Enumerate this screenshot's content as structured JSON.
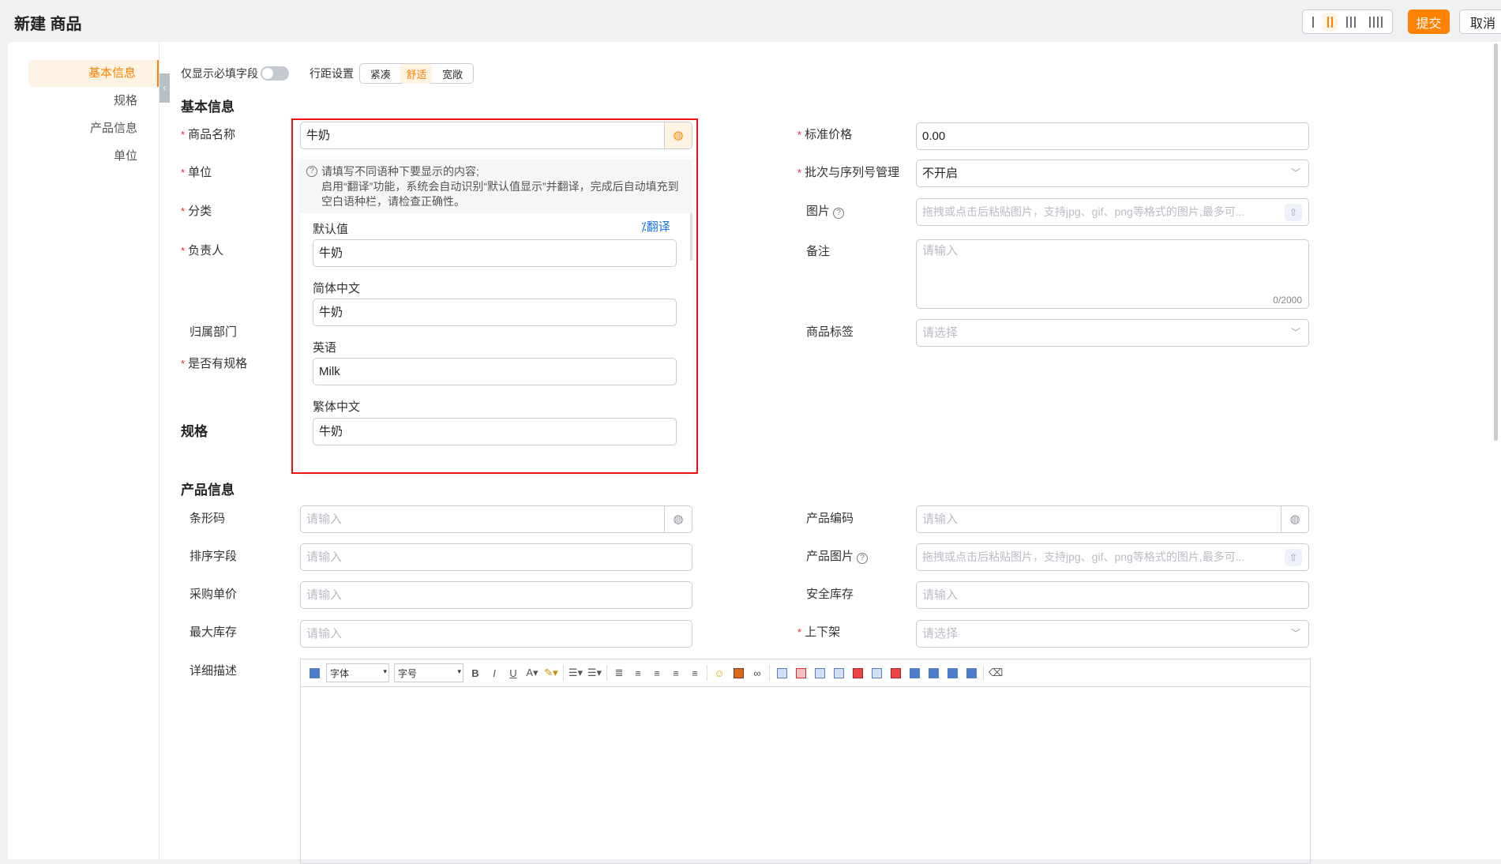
{
  "header": {
    "title": "新建 商品",
    "submit": "提交",
    "cancel": "取消",
    "density_options": [
      "1列",
      "2列",
      "3列",
      "4列"
    ],
    "density_selected": 1
  },
  "nav": {
    "items": [
      "基本信息",
      "规格",
      "产品信息",
      "单位"
    ],
    "active": 0
  },
  "toolbar": {
    "required_only_label": "仅显示必填字段",
    "required_only": false,
    "line_spacing_label": "行距设置",
    "spacing_options": [
      "紧凑",
      "舒适",
      "宽敞"
    ],
    "spacing_selected": "舒适"
  },
  "sections": {
    "basic": "基本信息",
    "spec": "规格",
    "product": "产品信息"
  },
  "basic": {
    "name": {
      "label": "商品名称",
      "value": "牛奶",
      "required": true
    },
    "unit": {
      "label": "单位",
      "required": true
    },
    "category": {
      "label": "分类",
      "required": true
    },
    "owner": {
      "label": "负责人",
      "required": true
    },
    "dept": {
      "label": "归属部门"
    },
    "has_spec": {
      "label": "是否有规格",
      "required": true
    },
    "price": {
      "label": "标准价格",
      "value": "0.00",
      "required": true
    },
    "batch": {
      "label": "批次与序列号管理",
      "value": "不开启",
      "required": true
    },
    "image": {
      "label": "图片",
      "placeholder": "拖拽或点击后粘贴图片，支持jpg、gif、png等格式的图片,最多可..."
    },
    "remark": {
      "label": "备注",
      "placeholder": "请输入",
      "counter": "0/2000"
    },
    "tags": {
      "label": "商品标签",
      "placeholder": "请选择"
    }
  },
  "i18n_popover": {
    "note_line1": "请填写不同语种下要显示的内容;",
    "note_line2": "启用“翻译”功能，系统会自动识别“默认值显示”并翻译，完成后自动填充到空白语种栏，请检查正确性。",
    "translate": "翻译",
    "fields": [
      {
        "label": "默认值",
        "value": "牛奶"
      },
      {
        "label": "简体中文",
        "value": "牛奶"
      },
      {
        "label": "英语",
        "value": "Milk"
      },
      {
        "label": "繁体中文",
        "value": "牛奶"
      }
    ]
  },
  "product": {
    "barcode": {
      "label": "条形码",
      "placeholder": "请输入"
    },
    "sort": {
      "label": "排序字段",
      "placeholder": "请输入"
    },
    "purchase_price": {
      "label": "采购单价",
      "placeholder": "请输入"
    },
    "max_stock": {
      "label": "最大库存",
      "placeholder": "请输入"
    },
    "description": {
      "label": "详细描述"
    },
    "code": {
      "label": "产品编码",
      "placeholder": "请输入"
    },
    "image": {
      "label": "产品图片",
      "placeholder": "拖拽或点击后粘贴图片，支持jpg、gif、png等格式的图片,最多可..."
    },
    "safety_stock": {
      "label": "安全库存",
      "placeholder": "请输入"
    },
    "shelf": {
      "label": "上下架",
      "placeholder": "请选择",
      "required": true
    }
  },
  "editor": {
    "font": "字体",
    "size": "字号"
  },
  "colors": {
    "accent": "#ff8200",
    "required": "#e23",
    "highlight_box": "#f01010",
    "link": "#1a73e8"
  }
}
